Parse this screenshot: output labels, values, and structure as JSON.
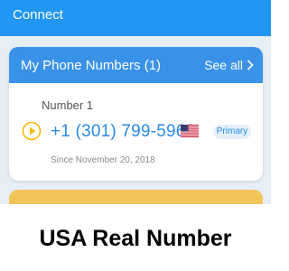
{
  "appbar": {
    "title": "Connect"
  },
  "phone_card": {
    "title": "My Phone Numbers (1)",
    "see_all_label": "See all",
    "number_caption": "Number 1",
    "phone_number": "+1 (301) 799-5969",
    "badge": "Primary",
    "since": "Since November 20, 2018",
    "flag_icon": "us-flag-icon"
  },
  "banner": {
    "text": "USA Real Number"
  },
  "colors": {
    "appbar": "#2196f3",
    "card_header": "#3a92e8",
    "accent_blue": "#2a8be6",
    "play_yellow": "#f5b800",
    "next_card": "#f2c45a"
  }
}
